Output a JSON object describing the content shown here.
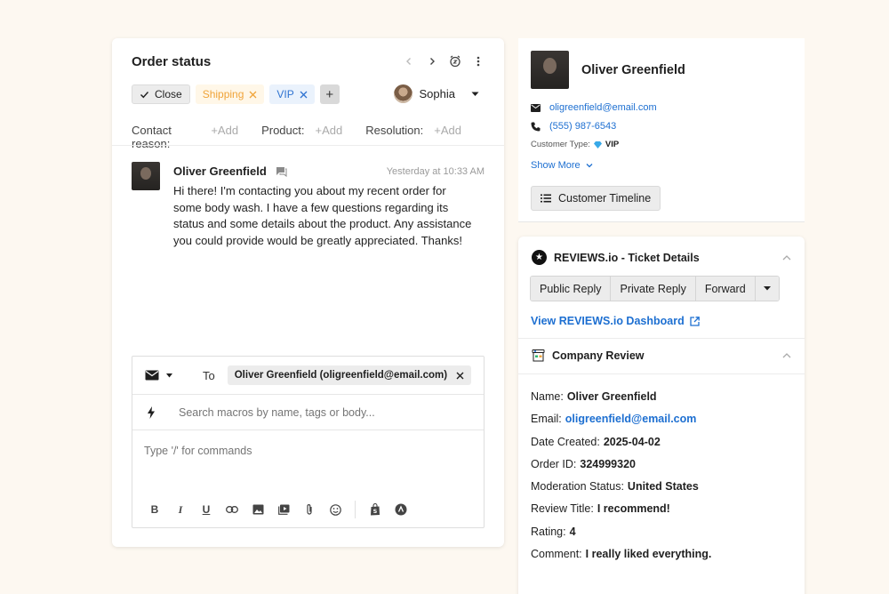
{
  "ticket": {
    "title": "Order status",
    "tags": {
      "close": "Close",
      "shipping": "Shipping",
      "vip": "VIP",
      "add": "+"
    },
    "assignee": "Sophia",
    "fields": [
      {
        "label": "Contact reason:",
        "value": "+Add"
      },
      {
        "label": "Product:",
        "value": "+Add"
      },
      {
        "label": "Resolution:",
        "value": "+Add"
      }
    ],
    "message": {
      "author": "Oliver Greenfield",
      "time": "Yesterday at 10:33 AM",
      "body": "Hi there! I'm contacting you about my recent order for some body wash. I have a few questions regarding its status and some details about the product. Any assistance you could provide would be greatly appreciated. Thanks!"
    },
    "composer": {
      "to_label": "To",
      "recipient": "Oliver Greenfield (oligreenfield@email.com)",
      "macros_placeholder": "Search macros by name, tags or body...",
      "body_placeholder": "Type '/' for commands"
    }
  },
  "customer": {
    "name": "Oliver Greenfield",
    "email": "oligreenfield@email.com",
    "phone": "(555) 987-6543",
    "type_label": "Customer Type:",
    "type_value": "VIP",
    "show_more": "Show More",
    "timeline_button": "Customer Timeline"
  },
  "reviews": {
    "title": "REVIEWS.io - Ticket Details",
    "buttons": {
      "public_reply": "Public Reply",
      "private_reply": "Private Reply",
      "forward": "Forward"
    },
    "dashboard_link": "View REVIEWS.io Dashboard",
    "company_review_title": "Company Review",
    "details": [
      {
        "label": "Name:",
        "value": "Oliver Greenfield"
      },
      {
        "label": "Email:",
        "value": "oligreenfield@email.com"
      },
      {
        "label": "Date Created:",
        "value": "2025-04-02"
      },
      {
        "label": "Order ID:",
        "value": "324999320"
      },
      {
        "label": "Moderation Status:",
        "value": "United States"
      },
      {
        "label": "Review Title:",
        "value": "I recommend!"
      },
      {
        "label": "Rating:",
        "value": "4"
      },
      {
        "label": "Comment:",
        "value": "I really liked everything."
      }
    ]
  }
}
